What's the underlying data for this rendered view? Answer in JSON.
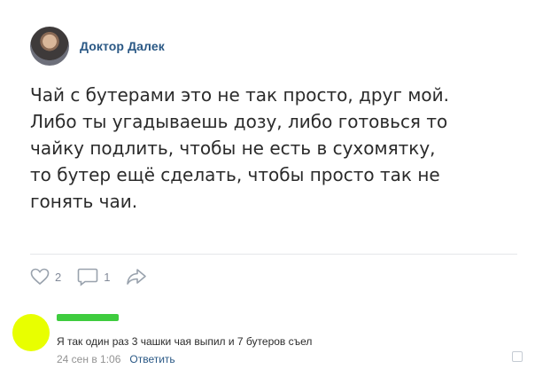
{
  "post": {
    "author": "Доктор Далек",
    "text": "Чай с бутерами это не так просто, друг мой.\nЛибо ты угадываешь дозу, либо готовься то\nчайку подлить, чтобы не есть в сухомятку,\nто бутер ещё сделать, чтобы просто так не\nгонять чаи.",
    "likes": "2",
    "comments": "1"
  },
  "comment": {
    "text": "Я так один раз 3 чашки чая выпил и 7 бутеров съел",
    "date": "24 сен в 1:06",
    "reply_label": "Ответить"
  },
  "icons": {
    "like": "heart-icon",
    "comment": "comment-icon",
    "share": "share-icon"
  },
  "colors": {
    "accent": "#2a5885",
    "avatar_highlight": "#e8ff00",
    "name_censor": "#3fcc3f"
  }
}
